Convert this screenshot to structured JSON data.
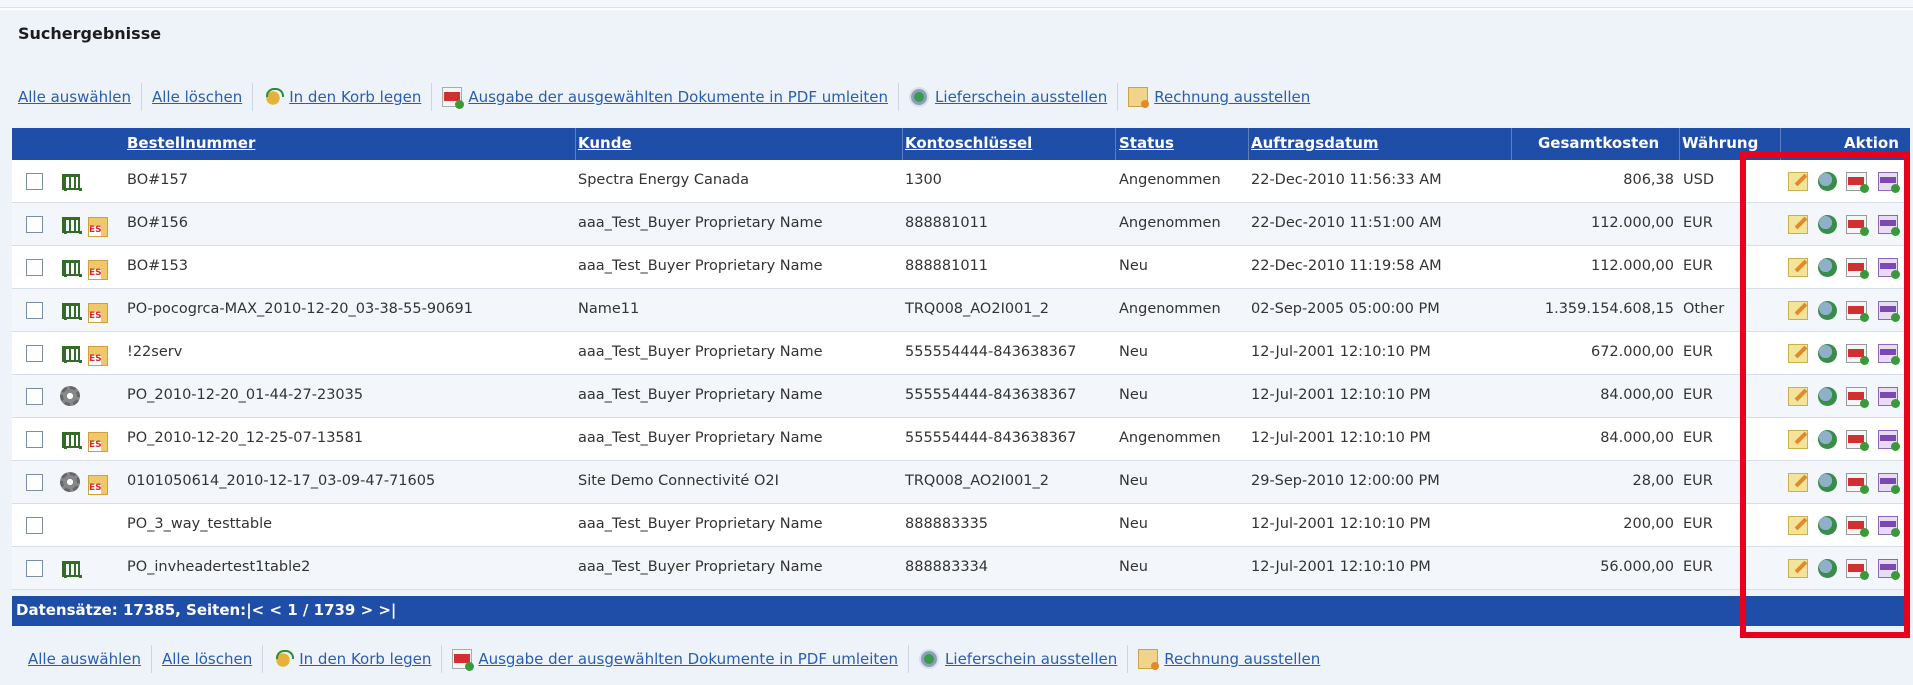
{
  "page": {
    "title": "Suchergebnisse"
  },
  "toolbar": {
    "select_all": "Alle auswählen",
    "clear_all": "Alle löschen",
    "add_to_cart": "In den Korb legen",
    "export_pdf": "Ausgabe der ausgewählten Dokumente in PDF umleiten",
    "issue_delivery": "Lieferschein ausstellen",
    "issue_invoice": "Rechnung ausstellen"
  },
  "table": {
    "headers": {
      "order_number": "Bestellnummer",
      "customer": "Kunde",
      "account_key": "Kontoschlüssel",
      "status": "Status",
      "order_date": "Auftragsdatum",
      "total": "Gesamtkosten",
      "currency": "Währung",
      "actions": "Aktion"
    },
    "rows": [
      {
        "order": "BO#157",
        "customer": "Spectra Energy Canada",
        "account": "1300",
        "status": "Angenommen",
        "date": "22-Dec-2010 11:56:33 AM",
        "total": "806,38",
        "currency": "USD",
        "cart": true,
        "gear": false,
        "es": false
      },
      {
        "order": "BO#156",
        "customer": "aaa_Test_Buyer Proprietary Name",
        "account": "888881011",
        "status": "Angenommen",
        "date": "22-Dec-2010 11:51:00 AM",
        "total": "112.000,00",
        "currency": "EUR",
        "cart": true,
        "gear": false,
        "es": true
      },
      {
        "order": "BO#153",
        "customer": "aaa_Test_Buyer Proprietary Name",
        "account": "888881011",
        "status": "Neu",
        "date": "22-Dec-2010 11:19:58 AM",
        "total": "112.000,00",
        "currency": "EUR",
        "cart": true,
        "gear": false,
        "es": true
      },
      {
        "order": "PO-pocogrca-MAX_2010-12-20_03-38-55-90691",
        "customer": "Name11",
        "account": "TRQ008_AO2I001_2",
        "status": "Angenommen",
        "date": "02-Sep-2005 05:00:00 PM",
        "total": "1.359.154.608,15",
        "currency": "Other",
        "cart": true,
        "gear": false,
        "es": true
      },
      {
        "order": "!22serv",
        "customer": "aaa_Test_Buyer Proprietary Name",
        "account": "555554444-843638367",
        "status": "Neu",
        "date": "12-Jul-2001 12:10:10 PM",
        "total": "672.000,00",
        "currency": "EUR",
        "cart": true,
        "gear": false,
        "es": true
      },
      {
        "order": "PO_2010-12-20_01-44-27-23035",
        "customer": "aaa_Test_Buyer Proprietary Name",
        "account": "555554444-843638367",
        "status": "Neu",
        "date": "12-Jul-2001 12:10:10 PM",
        "total": "84.000,00",
        "currency": "EUR",
        "cart": false,
        "gear": true,
        "es": false
      },
      {
        "order": "PO_2010-12-20_12-25-07-13581",
        "customer": "aaa_Test_Buyer Proprietary Name",
        "account": "555554444-843638367",
        "status": "Angenommen",
        "date": "12-Jul-2001 12:10:10 PM",
        "total": "84.000,00",
        "currency": "EUR",
        "cart": true,
        "gear": false,
        "es": true
      },
      {
        "order": "0101050614_2010-12-17_03-09-47-71605",
        "customer": "Site Demo Connectivité O2I",
        "account": "TRQ008_AO2I001_2",
        "status": "Neu",
        "date": "29-Sep-2010 12:00:00 PM",
        "total": "28,00",
        "currency": "EUR",
        "cart": false,
        "gear": true,
        "es": true
      },
      {
        "order": "PO_3_way_testtable",
        "customer": "aaa_Test_Buyer Proprietary Name",
        "account": "888883335",
        "status": "Neu",
        "date": "12-Jul-2001 12:10:10 PM",
        "total": "200,00",
        "currency": "EUR",
        "cart": false,
        "gear": false,
        "es": false
      },
      {
        "order": "PO_invheadertest1table2",
        "customer": "aaa_Test_Buyer Proprietary Name",
        "account": "888883334",
        "status": "Neu",
        "date": "12-Jul-2001 12:10:10 PM",
        "total": "56.000,00",
        "currency": "EUR",
        "cart": true,
        "gear": false,
        "es": false
      }
    ]
  },
  "pagination": {
    "records_label": "Datensätze: 17385, Seiten:",
    "nav": "|< < 1 / 1739 > >|"
  },
  "colors": {
    "header_blue": "#1f4ea8",
    "link": "#2a5db0",
    "highlight": "#e8001c",
    "panel_bg": "#eef3f9"
  },
  "icons": [
    "basket-icon",
    "pdf-icon",
    "delivery-note-icon",
    "invoice-icon",
    "cart-icon",
    "gear-icon",
    "es-icon",
    "edit-icon",
    "globe-icon",
    "pdf-export-icon",
    "document-icon"
  ]
}
